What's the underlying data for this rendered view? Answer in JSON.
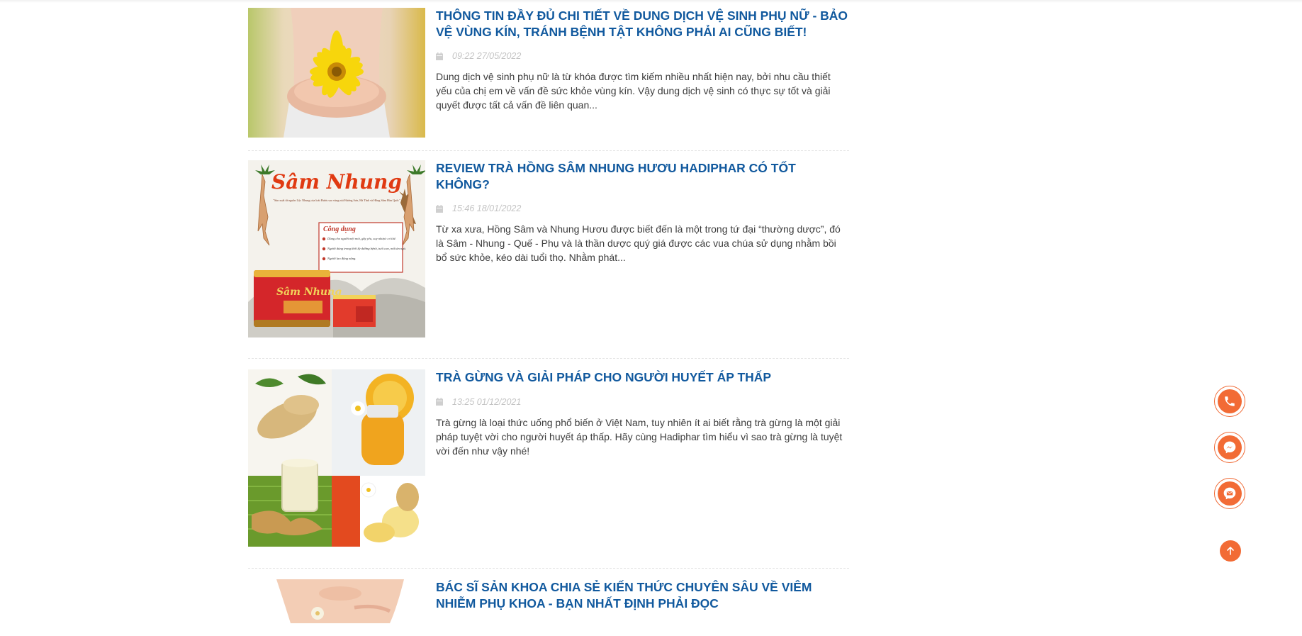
{
  "articles": [
    {
      "title": "THÔNG TIN ĐẦY ĐỦ CHI TIẾT VỀ DUNG DỊCH VỆ SINH PHỤ NỮ - BẢO VỆ VÙNG KÍN, TRÁNH BỆNH TẬT KHÔNG PHẢI AI CŨNG BIẾT!",
      "date": "09:22 27/05/2022",
      "excerpt": "Dung dịch vệ sinh phụ nữ là từ khóa được tìm kiếm nhiều nhất hiện nay, bởi nhu cầu thiết yếu của chị em về vấn đề sức khỏe vùng kín. Vậy dung dịch vệ sinh có thực sự tốt và giải quyết được tất cả vấn đề liên quan..."
    },
    {
      "title": "REVIEW TRÀ HỒNG SÂM NHUNG HƯƠU HADIPHAR CÓ TỐT KHÔNG?",
      "date": "15:46 18/01/2022",
      "excerpt": "Từ xa xưa, Hồng Sâm và Nhung Hươu được biết đến là một trong tứ đại “thường dược”, đó là Sâm - Nhung - Quế - Phụ và là thần dược quý giá được các vua chúa sử dụng nhằm bồi bổ sức khỏe, kéo dài tuổi thọ. Nhằm phát...",
      "image_text": {
        "brand": "Sâm Nhung",
        "tagline": "\"Sản xuất từ nguồn Lộc Nhung của loài Hươu sao vùng núi Hương Sơn, Hà Tĩnh và Hồng Sâm Hàn Quốc\"",
        "uses_title": "Công dụng",
        "uses": [
          "Dùng cho người mệt mỏi, gầy yếu, suy nhược cơ thể.",
          "Người dùng trong thời kỳ dưỡng bệnh, tuổi cao, mất ăn ngủ.",
          "Người lao động nặng."
        ]
      }
    },
    {
      "title": "TRÀ GỪNG VÀ GIẢI PHÁP CHO NGƯỜI HUYẾT ÁP THẤP",
      "date": "13:25 01/12/2021",
      "excerpt": "Trà gừng là loại thức uống phổ biến ở Việt Nam, tuy nhiên ít ai biết rằng trà gừng là một giải pháp tuyệt vời cho người huyết áp thấp. Hãy cùng Hadiphar tìm hiểu vì sao trà gừng là tuyệt vời đến như vậy nhé!"
    },
    {
      "title": "BÁC SĨ SẢN KHOA CHIA SẺ KIẾN THỨC CHUYÊN SÂU VỀ VIÊM NHIỄM PHỤ KHOA - BẠN NHẤT ĐỊNH PHẢI ĐỌC",
      "date": "",
      "excerpt": ""
    }
  ],
  "floating_buttons": [
    {
      "icon": "phone-icon"
    },
    {
      "icon": "messenger-icon"
    },
    {
      "icon": "mail-icon"
    }
  ],
  "scroll_top": {
    "icon": "arrow-up-icon"
  },
  "colors": {
    "title": "#11599e",
    "accent": "#f26b35",
    "date": "#c4c4c4",
    "text": "#3c3c3c"
  }
}
